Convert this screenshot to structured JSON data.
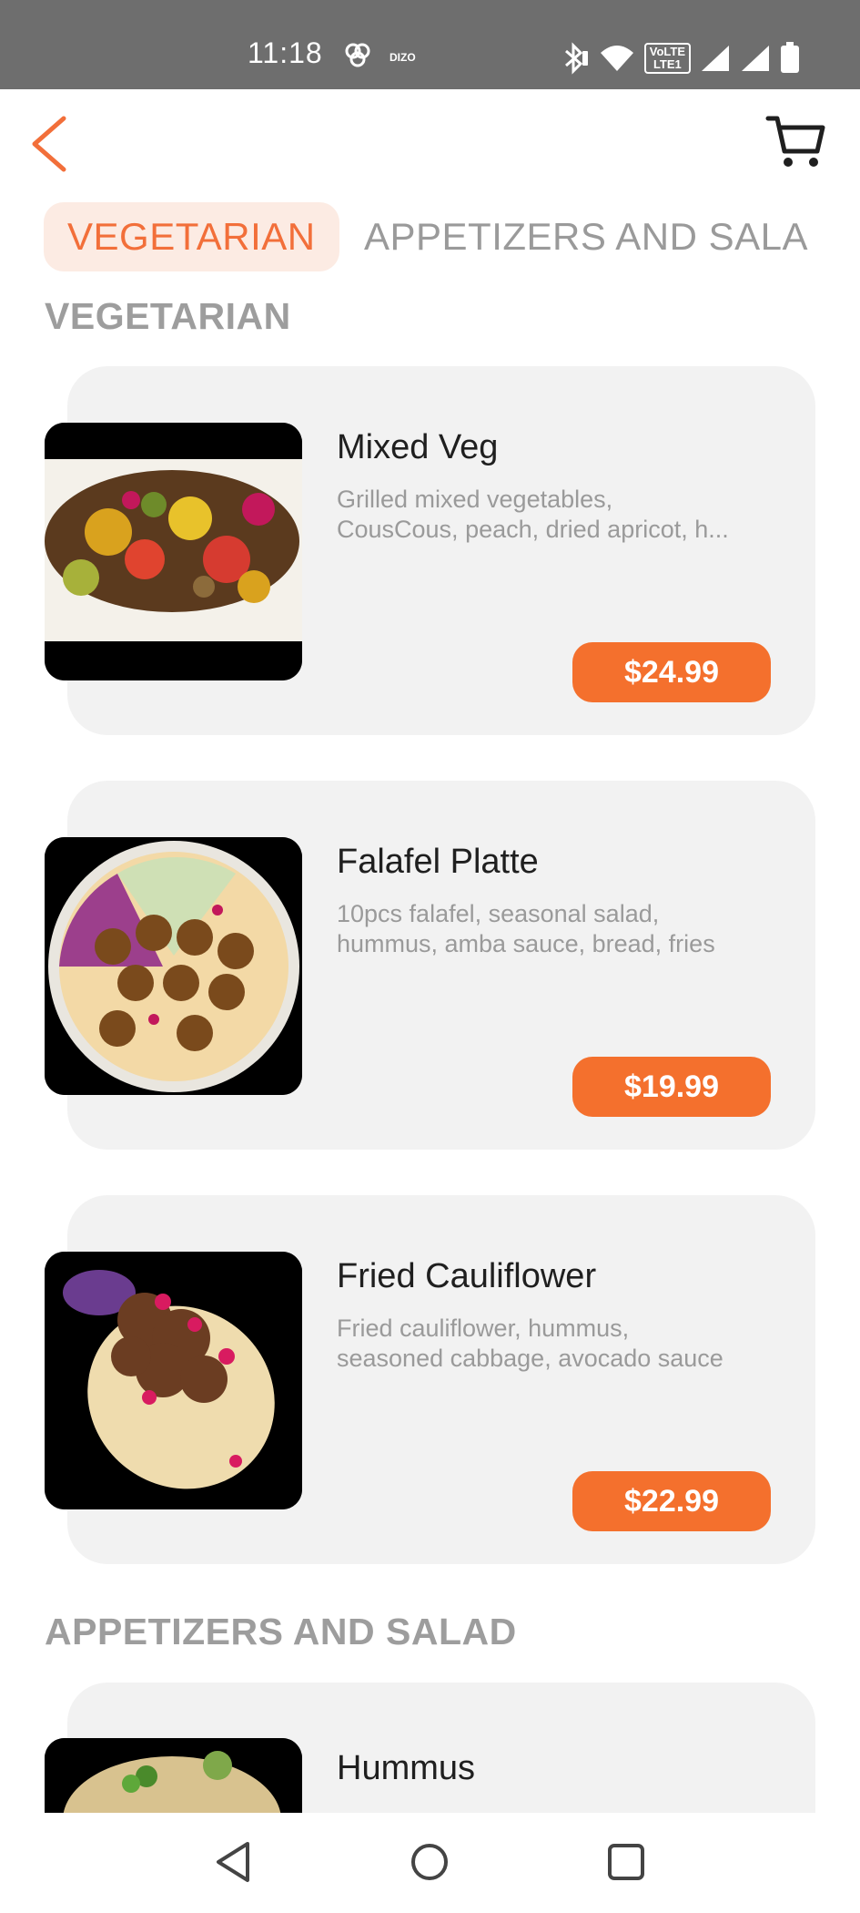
{
  "status_bar": {
    "time": "11:18",
    "brand": "DIZO",
    "lte_top": "VoLTE",
    "lte_bottom": "LTE1"
  },
  "header": {
    "back_icon": "chevron-left-icon",
    "cart_icon": "shopping-cart-icon",
    "accent_color": "#f26f3a"
  },
  "tabs": [
    {
      "label": "VEGETARIAN",
      "active": true
    },
    {
      "label": "APPETIZERS AND SALA",
      "active": false
    }
  ],
  "sections": [
    {
      "title": "VEGETARIAN",
      "items": [
        {
          "name": "Mixed Veg",
          "description": "Grilled mixed vegetables,\nCousCous, peach, dried apricot, h...",
          "price": "$24.99"
        },
        {
          "name": "Falafel Platte",
          "description": "10pcs falafel, seasonal salad,\nhummus, amba sauce, bread, fries",
          "price": "$19.99"
        },
        {
          "name": "Fried Cauliflower",
          "description": "Fried cauliflower, hummus,\nseasoned cabbage, avocado sauce",
          "price": "$22.99"
        }
      ]
    },
    {
      "title": "APPETIZERS AND SALAD",
      "items": [
        {
          "name": "Hummus"
        }
      ]
    }
  ],
  "nav_bar": {
    "back": "nav-back-icon",
    "home": "nav-home-icon",
    "recents": "nav-recents-icon"
  },
  "colors": {
    "price_button": "#f4702d",
    "card_background": "#f2f2f2",
    "section_title": "#9d9d9d"
  }
}
